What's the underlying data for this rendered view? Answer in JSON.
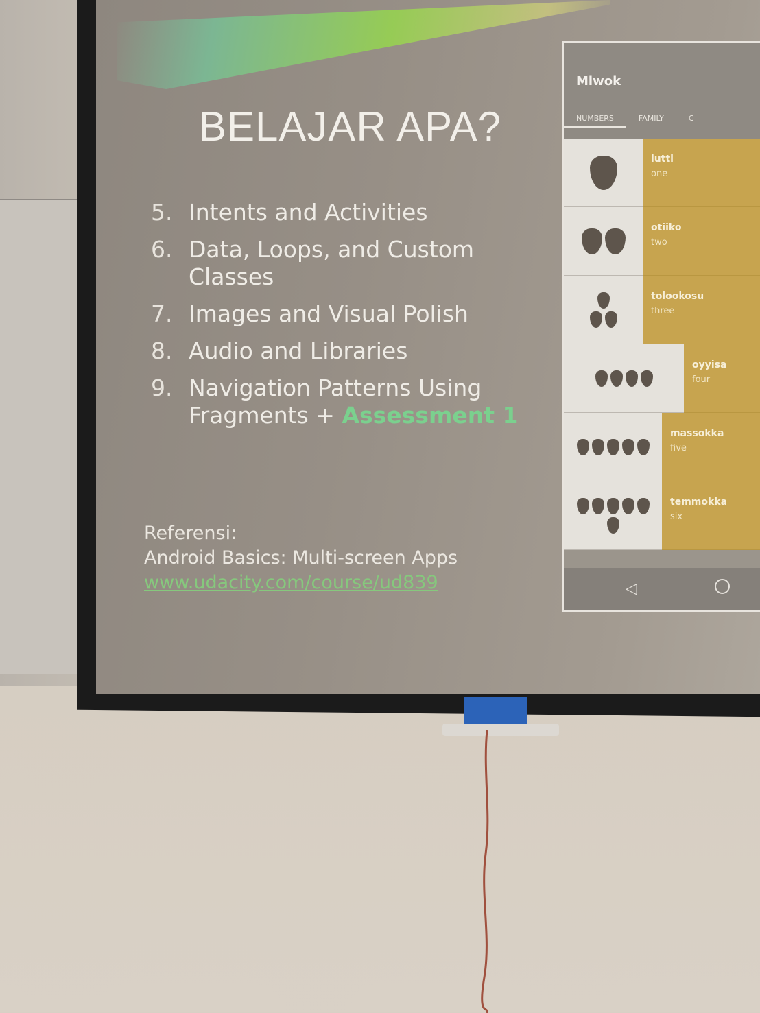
{
  "slide": {
    "title": "BELAJAR APA?",
    "topics": [
      {
        "num": "5.",
        "text": "Intents and Activities"
      },
      {
        "num": "6.",
        "text": "Data, Loops, and Custom Classes"
      },
      {
        "num": "7.",
        "text": "Images and Visual Polish"
      },
      {
        "num": "8.",
        "text": "Audio and Libraries"
      },
      {
        "num": "9.",
        "text": "Navigation Patterns Using Fragments + ",
        "accent": "Assessment 1"
      }
    ],
    "reference": {
      "label": "Referensi:",
      "course": "Android Basics: Multi-screen Apps",
      "link": "www.udacity.com/course/ud839"
    }
  },
  "phone": {
    "app_title": "Miwok",
    "tabs": [
      "NUMBERS",
      "FAMILY",
      "C"
    ],
    "rows": [
      {
        "miwok": "lutti",
        "english": "one",
        "count": 1
      },
      {
        "miwok": "otiiko",
        "english": "two",
        "count": 2
      },
      {
        "miwok": "tolookosu",
        "english": "three",
        "count": 3
      },
      {
        "miwok": "oyyisa",
        "english": "four",
        "count": 4
      },
      {
        "miwok": "massokka",
        "english": "five",
        "count": 5
      },
      {
        "miwok": "temmokka",
        "english": "six",
        "count": 6
      }
    ],
    "nav_icons": [
      "back-icon",
      "home-icon"
    ]
  },
  "colors": {
    "slide_bg": "#978f86",
    "accent_green": "#7bd08e",
    "list_text_bg": "#c7a44f",
    "tape_blue": "#2c63b8"
  }
}
